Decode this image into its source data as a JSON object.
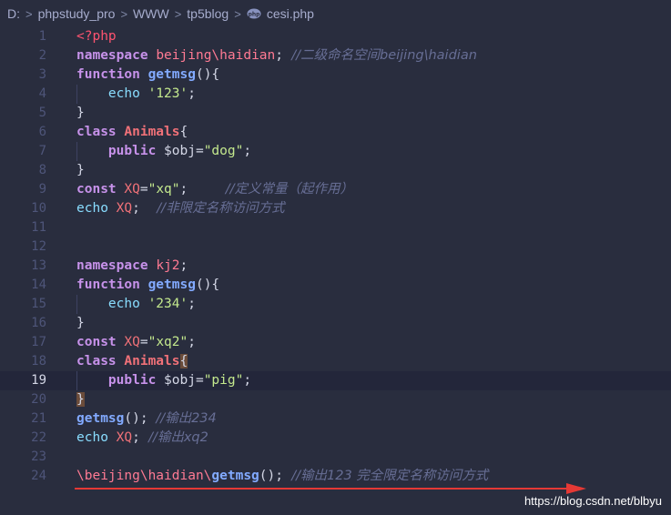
{
  "breadcrumb": {
    "items": [
      "D:",
      "phpstudy_pro",
      "WWW",
      "tp5blog",
      "cesi.php"
    ]
  },
  "editor": {
    "lines": [
      {
        "n": "1",
        "tokens": [
          [
            "<?php",
            "k-tag"
          ]
        ]
      },
      {
        "n": "2",
        "tokens": [
          [
            "namespace ",
            "k-bold"
          ],
          [
            "beijing\\haidian",
            "k-ns"
          ],
          [
            ";",
            "k-plain"
          ],
          [
            "  //二级命名空间beijing\\haidian",
            "k-comment"
          ]
        ]
      },
      {
        "n": "3",
        "tokens": [
          [
            "function ",
            "k-bold"
          ],
          [
            "getmsg",
            "k-fn"
          ],
          [
            "(){",
            "k-plain"
          ]
        ]
      },
      {
        "n": "4",
        "tokens": [
          [
            "    echo ",
            "k-echo"
          ],
          [
            "'123'",
            "k-str"
          ],
          [
            ";",
            "k-plain"
          ]
        ]
      },
      {
        "n": "5",
        "tokens": [
          [
            "}",
            "k-plain"
          ]
        ]
      },
      {
        "n": "6",
        "tokens": [
          [
            "class ",
            "k-bold"
          ],
          [
            "Animals",
            "k-cls"
          ],
          [
            "{",
            "k-plain"
          ]
        ]
      },
      {
        "n": "7",
        "tokens": [
          [
            "    public ",
            "k-bold"
          ],
          [
            "$obj=",
            "k-plain"
          ],
          [
            "\"dog\"",
            "k-str"
          ],
          [
            ";",
            "k-plain"
          ]
        ]
      },
      {
        "n": "8",
        "tokens": [
          [
            "}",
            "k-plain"
          ]
        ]
      },
      {
        "n": "9",
        "tokens": [
          [
            "const ",
            "k-bold"
          ],
          [
            "XQ",
            "k-const"
          ],
          [
            "=",
            "k-plain"
          ],
          [
            "\"xq\"",
            "k-str"
          ],
          [
            ";",
            "k-plain"
          ],
          [
            "         //定义常量（起作用）",
            "k-comment"
          ]
        ]
      },
      {
        "n": "10",
        "tokens": [
          [
            "echo ",
            "k-echo"
          ],
          [
            "XQ",
            "k-const"
          ],
          [
            ";",
            "k-plain"
          ],
          [
            "    //非限定名称访问方式",
            "k-comment"
          ]
        ]
      },
      {
        "n": "11",
        "tokens": []
      },
      {
        "n": "12",
        "tokens": []
      },
      {
        "n": "13",
        "tokens": [
          [
            "namespace ",
            "k-bold"
          ],
          [
            "kj2",
            "k-ns"
          ],
          [
            ";",
            "k-plain"
          ]
        ]
      },
      {
        "n": "14",
        "tokens": [
          [
            "function ",
            "k-bold"
          ],
          [
            "getmsg",
            "k-fn"
          ],
          [
            "(){",
            "k-plain"
          ]
        ]
      },
      {
        "n": "15",
        "tokens": [
          [
            "    echo ",
            "k-echo"
          ],
          [
            "'234'",
            "k-str"
          ],
          [
            ";",
            "k-plain"
          ]
        ]
      },
      {
        "n": "16",
        "tokens": [
          [
            "}",
            "k-plain"
          ]
        ]
      },
      {
        "n": "17",
        "tokens": [
          [
            "const ",
            "k-bold"
          ],
          [
            "XQ",
            "k-const"
          ],
          [
            "=",
            "k-plain"
          ],
          [
            "\"xq2\"",
            "k-str"
          ],
          [
            ";",
            "k-plain"
          ]
        ]
      },
      {
        "n": "18",
        "tokens": [
          [
            "class ",
            "k-bold"
          ],
          [
            "Animals",
            "k-cls"
          ],
          [
            "{",
            "k-bracket-hl"
          ]
        ]
      },
      {
        "n": "19",
        "tokens": [
          [
            "    public ",
            "k-bold"
          ],
          [
            "$obj=",
            "k-plain"
          ],
          [
            "\"pig\"",
            "k-str"
          ],
          [
            ";",
            "k-plain"
          ]
        ]
      },
      {
        "n": "20",
        "tokens": [
          [
            "}",
            "k-bracket-hl"
          ]
        ]
      },
      {
        "n": "21",
        "tokens": [
          [
            "getmsg",
            "k-fn"
          ],
          [
            "(); ",
            "k-plain"
          ],
          [
            "//输出234",
            "k-comment"
          ]
        ]
      },
      {
        "n": "22",
        "tokens": [
          [
            "echo ",
            "k-echo"
          ],
          [
            "XQ",
            "k-const"
          ],
          [
            ";",
            "k-plain"
          ],
          [
            "  //输出xq2",
            "k-comment"
          ]
        ]
      },
      {
        "n": "23",
        "tokens": []
      },
      {
        "n": "24",
        "tokens": [
          [
            "\\beijing\\haidian\\",
            "k-ns"
          ],
          [
            "getmsg",
            "k-fn"
          ],
          [
            "();",
            "k-plain"
          ],
          [
            "  //输出123 完全限定名称访问方式",
            "k-comment"
          ]
        ]
      }
    ],
    "current_line": "19",
    "indent_guide_lines": [
      "4",
      "7",
      "15",
      "19"
    ]
  },
  "annotation": {
    "arrow_color": "#e53935"
  },
  "watermark": "https://blog.csdn.net/blbyu"
}
